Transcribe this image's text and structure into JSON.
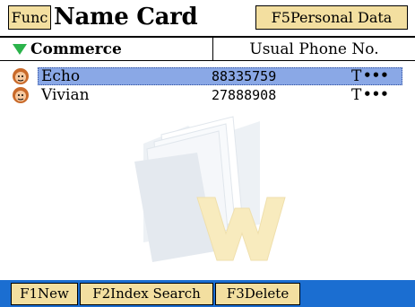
{
  "header": {
    "func_label": "Func",
    "title": "Name Card",
    "f5_label": "F5Personal Data"
  },
  "list_header": {
    "category": "Commerce",
    "column": "Usual Phone No."
  },
  "contacts": [
    {
      "name": "Echo",
      "phone": "88335759",
      "extra": "T",
      "more": "•••",
      "selected": true
    },
    {
      "name": "Vivian",
      "phone": "27888908",
      "extra": "T",
      "more": "•••",
      "selected": false
    }
  ],
  "footer": {
    "f1_label": "F1New",
    "f2_label": "F2Index Search",
    "f3_label": "F3Delete"
  },
  "colors": {
    "accent_button": "#f3dfa0",
    "footer_bg": "#1b6ed1",
    "selection": "#8aa8e6",
    "category_arrow": "#2bb34b"
  },
  "icons": {
    "category": "triangle-down-icon",
    "contact": "person-avatar-icon",
    "watermark": "folder-document-icon"
  }
}
